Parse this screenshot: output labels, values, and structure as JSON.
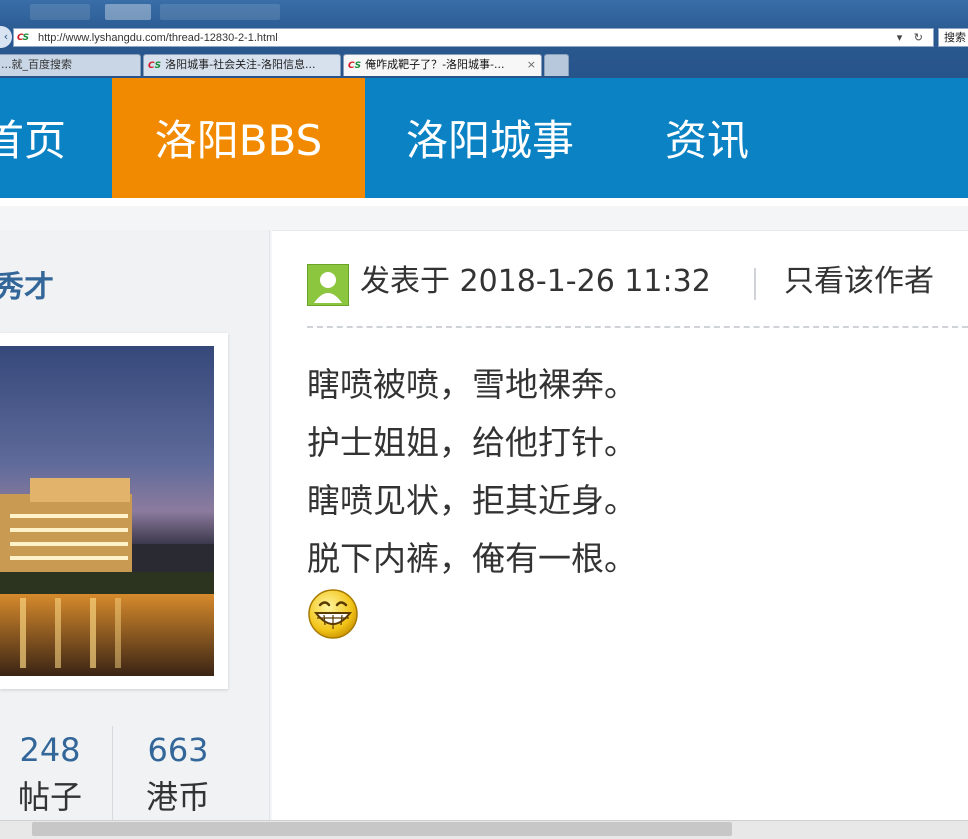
{
  "browser": {
    "address_url": "http://www.lyshangdu.com/thread-12830-2-1.html",
    "address_tools": "▾ ↻",
    "search_label": "搜索",
    "tabs": [
      {
        "label": "...就_百度搜索"
      },
      {
        "label": "洛阳城事-社会关注-洛阳信息..."
      },
      {
        "label": "俺咋成靶子了？-洛阳城事-...",
        "close": "×"
      }
    ]
  },
  "site_nav": {
    "items": [
      {
        "label": "首页"
      },
      {
        "label": "洛阳BBS"
      },
      {
        "label": "洛阳城事"
      },
      {
        "label": "资讯"
      }
    ],
    "active_color": "#f18a00",
    "bg_color": "#0a82c4"
  },
  "author": {
    "rank": "秀才",
    "stats": [
      {
        "value": "248",
        "label": "帖子"
      },
      {
        "value": "663",
        "label": "港币"
      }
    ]
  },
  "post": {
    "posted_at": "发表于 2018-1-26 11:32",
    "author_only": "只看该作者",
    "lines": [
      "瞎喷被喷，雪地裸奔。",
      "护士姐姐，给他打针。",
      "瞎喷见状，拒其近身。",
      "脱下内裤，俺有一根。"
    ],
    "emoji_icon": "grinning-face-icon"
  }
}
